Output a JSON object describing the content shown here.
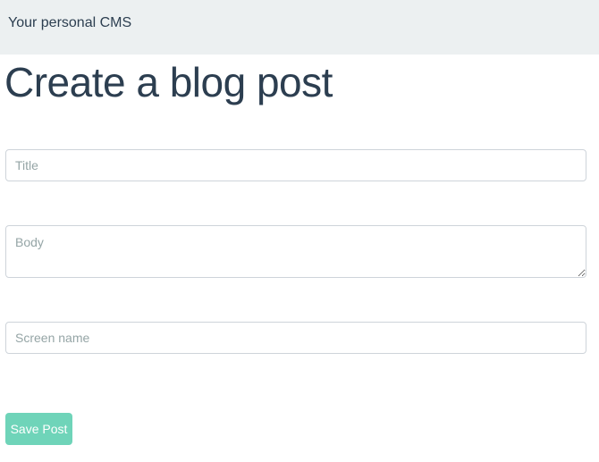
{
  "navbar": {
    "brand": "Your personal CMS"
  },
  "page": {
    "title": "Create a blog post"
  },
  "form": {
    "title_field": {
      "value": "",
      "placeholder": "Title"
    },
    "body_field": {
      "value": "",
      "placeholder": "Body"
    },
    "screen_name_field": {
      "value": "",
      "placeholder": "Screen name"
    },
    "save_label": "Save Post"
  },
  "colors": {
    "navbar_background": "#ecf0f1",
    "text": "#2c3e50",
    "save_button": "#6fd4b9",
    "placeholder": "#95a5a6"
  }
}
